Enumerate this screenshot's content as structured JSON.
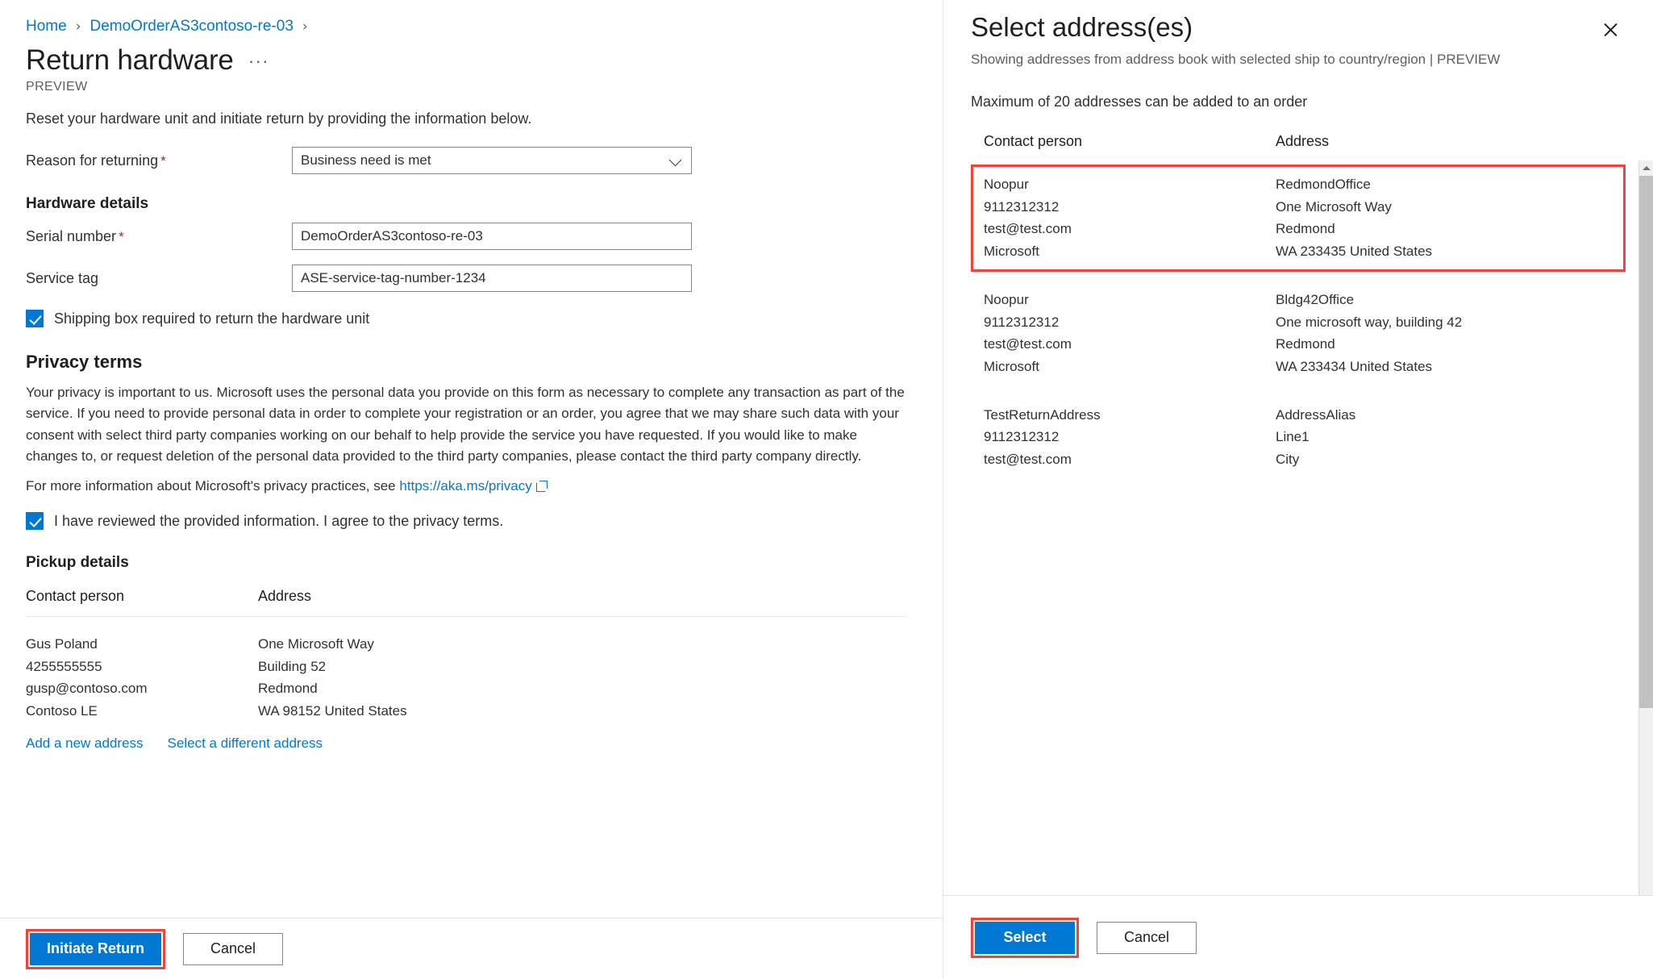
{
  "breadcrumb": {
    "items": [
      {
        "label": "Home"
      },
      {
        "label": "DemoOrderAS3contoso-re-03"
      }
    ],
    "separator": "›"
  },
  "page": {
    "title": "Return hardware",
    "more_actions": "···",
    "preview_tag": "PREVIEW",
    "intro": "Reset your hardware unit and initiate return by providing the information below."
  },
  "form": {
    "reason": {
      "label": "Reason for returning",
      "required_marker": "*",
      "value": "Business need is met"
    },
    "hardware_details_heading": "Hardware details",
    "serial_number": {
      "label": "Serial number",
      "required_marker": "*",
      "value": "DemoOrderAS3contoso-re-03"
    },
    "service_tag": {
      "label": "Service tag",
      "value": "ASE-service-tag-number-1234"
    },
    "shipping_box_checkbox": {
      "label": "Shipping box required to return the hardware unit",
      "checked": true
    }
  },
  "privacy": {
    "heading": "Privacy terms",
    "paragraph": "Your privacy is important to us. Microsoft uses the personal data you provide on this form as necessary to complete any transaction as part of the service. If you need to provide personal data in order to complete your registration or an order, you agree that we may share such data with your consent with select third party companies working on our behalf to help provide the service you have requested. If you would like to make changes to, or request deletion of the personal data provided to the third party companies, please contact the third party company directly.",
    "more_info_prefix": "For more information about Microsoft's privacy practices, see",
    "link_text": "https://aka.ms/privacy",
    "agree_checkbox": {
      "label": "I have reviewed the provided information. I agree to the privacy terms.",
      "checked": true
    }
  },
  "pickup": {
    "heading": "Pickup details",
    "columns": [
      "Contact person",
      "Address"
    ],
    "row": {
      "contact": [
        "Gus Poland",
        "4255555555",
        "gusp@contoso.com",
        "Contoso LE"
      ],
      "address": [
        "One Microsoft Way",
        "Building 52",
        "Redmond",
        "WA 98152 United States"
      ]
    },
    "links": [
      {
        "label": "Add a new address"
      },
      {
        "label": "Select a different address"
      }
    ]
  },
  "left_footer": {
    "primary_label": "Initiate Return",
    "cancel_label": "Cancel"
  },
  "panel": {
    "title": "Select address(es)",
    "subtitle": "Showing addresses from address book with selected ship to country/region | PREVIEW",
    "note": "Maximum of 20 addresses can be added to an order",
    "close_label": "×",
    "columns": [
      "Contact person",
      "Address"
    ],
    "rows": [
      {
        "selected": true,
        "contact": [
          "Noopur",
          "9112312312",
          "test@test.com",
          "Microsoft"
        ],
        "address": [
          "RedmondOffice",
          "One Microsoft Way",
          "Redmond",
          "WA 233435 United States"
        ]
      },
      {
        "selected": false,
        "contact": [
          "Noopur",
          "9112312312",
          "test@test.com",
          "Microsoft"
        ],
        "address": [
          "Bldg42Office",
          "One microsoft way, building 42",
          "Redmond",
          "WA 233434 United States"
        ]
      },
      {
        "selected": false,
        "contact": [
          "TestReturnAddress",
          "9112312312",
          "test@test.com"
        ],
        "address": [
          "AddressAlias",
          "Line1",
          "City"
        ]
      }
    ],
    "footer": {
      "primary_label": "Select",
      "cancel_label": "Cancel"
    }
  },
  "colors": {
    "accent": "#0078d4",
    "highlight": "#f0443a",
    "link": "#0078d4",
    "required": "#a4262c"
  }
}
